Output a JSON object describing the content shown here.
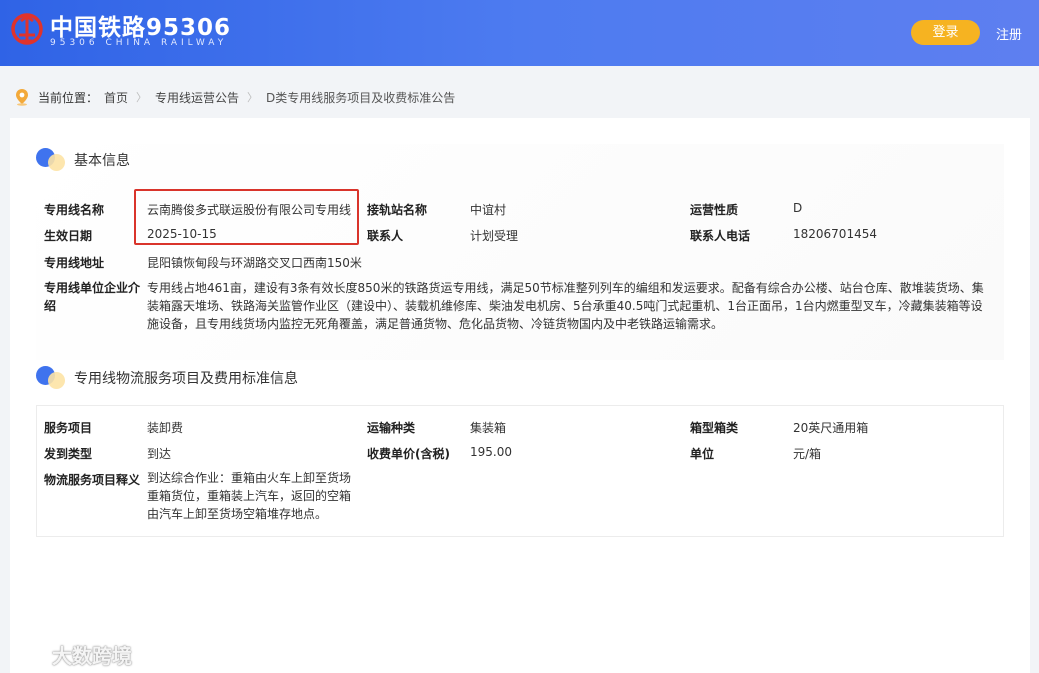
{
  "header": {
    "logo_title": "中国铁路95306",
    "logo_subtitle": "95306 CHINA RAILWAY",
    "logo_icon": "railway-logo-icon",
    "login_label": "登录",
    "register_label": "注册",
    "brand_color": "#3a6ee9",
    "login_color": "#f6b321"
  },
  "breadcrumb": {
    "label": "当前位置：",
    "items": [
      "首页",
      "专用线运营公告",
      "D类专用线服务项目及收费标准公告"
    ],
    "separator": "〉"
  },
  "basic_info": {
    "title": "基本信息",
    "line_name_label": "专用线名称",
    "line_name": "云南腾俊多式联运股份有限公司专用线",
    "station_label": "接轨站名称",
    "station": "中谊村",
    "nature_label": "运营性质",
    "nature": "D",
    "effective_date_label": "生效日期",
    "effective_date": "2025-10-15",
    "contact_label": "联系人",
    "contact": "计划受理",
    "phone_label": "联系人电话",
    "phone": "18206701454",
    "address_label": "专用线地址",
    "address": "昆阳镇恢甸段与环湖路交叉口西南150米",
    "intro_label": "专用线单位企业介绍",
    "intro": "专用线占地461亩，建设有3条有效长度850米的铁路货运专用线，满足50节标准整列列车的编组和发运要求。配备有综合办公楼、站台仓库、散堆装货场、集装箱露天堆场、铁路海关监管作业区（建设中）、装载机维修库、柴油发电机房、5台承重40.5吨门式起重机、1台正面吊，1台内燃重型叉车，冷藏集装箱等设施设备，且专用线货场内监控无死角覆盖，满足普通货物、危化品货物、冷链货物国内及中老铁路运输需求。"
  },
  "service_info": {
    "title": "专用线物流服务项目及费用标准信息",
    "item_label": "服务项目",
    "item": "装卸费",
    "transport_label": "运输种类",
    "transport": "集装箱",
    "box_label": "箱型箱类",
    "box": "20英尺通用箱",
    "type_label": "发到类型",
    "type": "到达",
    "price_label": "收费单价(含税)",
    "price": "195.00",
    "unit_label": "单位",
    "unit": "元/箱",
    "desc_label": "物流服务项目释义",
    "desc": "到达综合作业：重箱由火车上卸至货场重箱货位，重箱装上汽车，返回的空箱由汽车上卸至货场空箱堆存地点。"
  },
  "watermark": {
    "text": "大数跨境"
  }
}
